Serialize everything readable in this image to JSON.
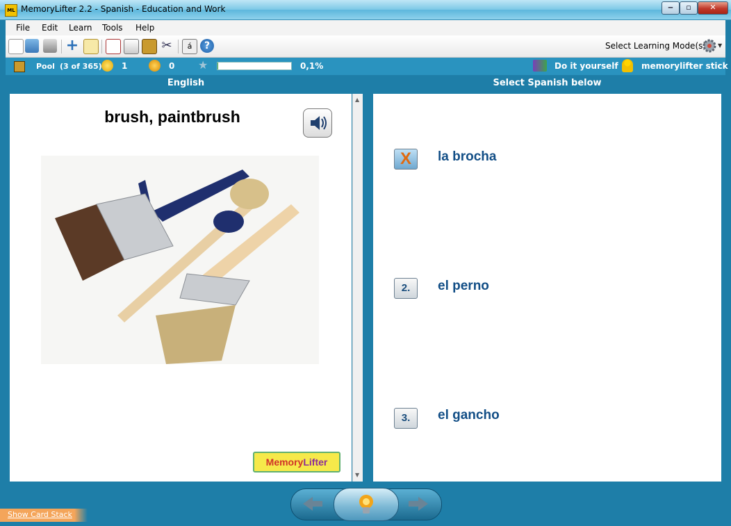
{
  "window": {
    "title": "MemoryLifter 2.2 - Spanish - Education and Work",
    "app_icon_text": "ML"
  },
  "menu": {
    "items": [
      "File",
      "Edit",
      "Learn",
      "Tools",
      "Help"
    ]
  },
  "toolbar": {
    "icons": [
      "new-document-icon",
      "open-folder-icon",
      "print-icon",
      "add-icon",
      "edit-notepad-icon",
      "presentation-icon",
      "card-stack-icon",
      "box-icon",
      "tools-icon",
      "special-char-icon",
      "help-icon"
    ],
    "mode_label": "Select Learning Mode(s)"
  },
  "status": {
    "pool_label": "Pool",
    "pool_count": "(3 of 365)",
    "correct_count": "1",
    "wrong_count": "0",
    "progress_fraction": 0.001,
    "progress_text": "0,1%",
    "dictionary_mode": "Do it yourself",
    "user_name": "memorylifter stick"
  },
  "question": {
    "header": "English",
    "word": "brush, paintbrush"
  },
  "answers": {
    "header": "Select Spanish below",
    "options": [
      {
        "key": "X",
        "text": "la brocha",
        "state": "wrong"
      },
      {
        "key": "2.",
        "text": "el perno",
        "state": "normal"
      },
      {
        "key": "3.",
        "text": "el gancho",
        "state": "normal"
      }
    ]
  },
  "logo": {
    "text_memory": "Memory",
    "text_lifter": "Lifter"
  },
  "bottom": {
    "show_card_stack": "Show Card Stack"
  }
}
